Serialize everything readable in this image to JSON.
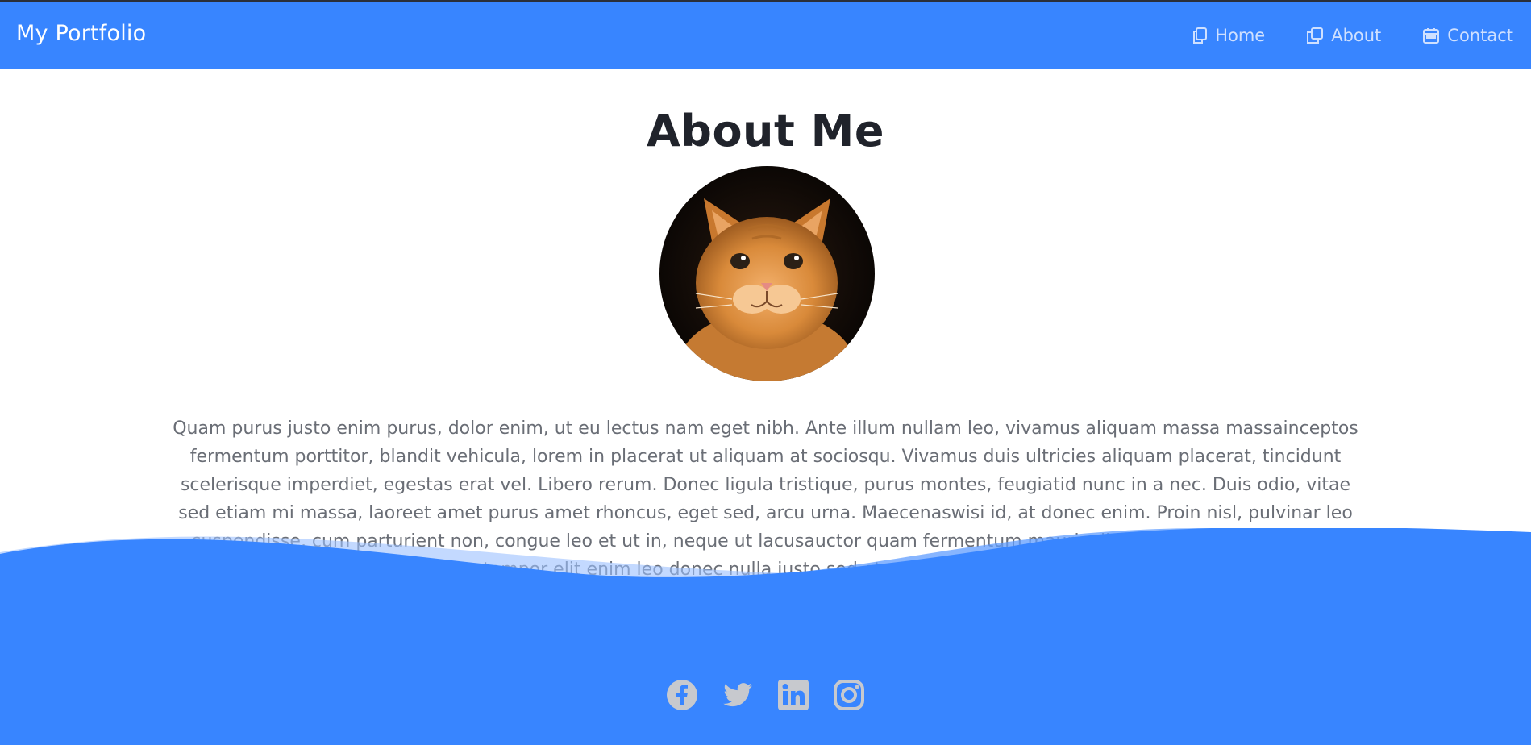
{
  "header": {
    "brand": "My Portfolio",
    "nav": [
      {
        "label": "Home",
        "icon": "copy-icon"
      },
      {
        "label": "About",
        "icon": "square-stack-icon"
      },
      {
        "label": "Contact",
        "icon": "calendar-icon"
      }
    ]
  },
  "about": {
    "title": "About Me",
    "avatar_icon": "kitten-photo",
    "bio": "Quam purus justo enim purus, dolor enim, ut eu lectus nam eget nibh. Ante illum nullam leo, vivamus aliquam massa massainceptos fermentum porttitor, blandit vehicula, lorem in placerat ut aliquam at sociosqu. Vivamus duis ultricies aliquam placerat, tincidunt scelerisque imperdiet, egestas erat vel. Libero rerum. Donec ligula tristique, purus montes, feugiatid nunc in a nec. Duis odio, vitae sed etiam mi massa, laoreet amet purus amet rhoncus, eget sed, arcu urna. Maecenaswisi id, at donec enim. Proin nisl, pulvinar leo suspendisse, cum parturient non, congue leo et ut in, neque ut lacusauctor quam fermentum mauris dictum aptent ultrices nulla viverra ornare, tempor elit enim leo donec nulla justo sed et, eget suspendisse lacus sed nunc"
  },
  "footer": {
    "socials": [
      "facebook-icon",
      "twitter-icon",
      "linkedin-icon",
      "instagram-icon"
    ]
  },
  "colors": {
    "primary": "#3885ff",
    "nav_text": "#cfe0ff",
    "title_text": "#20232b",
    "body_text": "#6a6e76",
    "social_icon": "#c7c9ce"
  }
}
